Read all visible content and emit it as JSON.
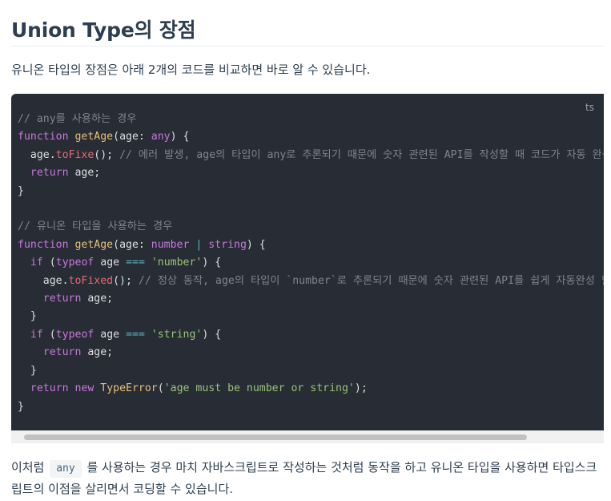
{
  "heading": "Union Type의 장점",
  "intro": "유니온 타입의 장점은 아래 2개의 코드를 비교하면 바로 알 수 있습니다.",
  "code": {
    "language": "ts",
    "lines": {
      "l1": "// any를 사용하는 경우",
      "l2_kw": "function",
      "l2_fn": "getAge",
      "l2_p1": "(age: ",
      "l2_type": "any",
      "l2_p2": ") {",
      "l3_obj": "age.",
      "l3_method": "toFixe",
      "l3_p": "();",
      "l3_comment": "// 에러 발생, age의 타입이 any로 추론되기 때문에 숫자 관련된 API를 작성할 때 코드가 자동 완성",
      "l4_kw": "return",
      "l4_rest": "age;",
      "l5": "}",
      "l7": "// 유니온 타입을 사용하는 경우",
      "l8_kw": "function",
      "l8_fn": "getAge",
      "l8_p1": "(age: ",
      "l8_t1": "number",
      "l8_op": "|",
      "l8_t2": "string",
      "l8_p2": ") {",
      "l9_kw1": "if",
      "l9_p1": "(",
      "l9_kw2": "typeof",
      "l9_p2": "age",
      "l9_op": "===",
      "l9_str": "'number'",
      "l9_p3": ") {",
      "l10_obj": "age.",
      "l10_method": "toFixed",
      "l10_p": "();",
      "l10_comment": "// 정상 동작, age의 타입이 `number`로 추론되기 때문에 숫자 관련된 API를 쉽게 자동완성 할",
      "l11_kw": "return",
      "l11_rest": "age;",
      "l12": "}",
      "l13_kw1": "if",
      "l13_p1": "(",
      "l13_kw2": "typeof",
      "l13_p2": "age",
      "l13_op": "===",
      "l13_str": "'string'",
      "l13_p3": ") {",
      "l14_kw": "return",
      "l14_rest": "age;",
      "l15": "}",
      "l16_kw1": "return",
      "l16_kw2": "new",
      "l16_cls": "TypeError",
      "l16_p1": "(",
      "l16_str": "'age must be number or string'",
      "l16_p2": ");",
      "l17": "}"
    }
  },
  "outro": {
    "before": "이처럼",
    "inline_code": "any",
    "after": "를 사용하는 경우 마치 자바스크립트로 작성하는 것처럼 동작을 하고 유니온 타입을 사용하면 타입스크립트의 이점을 살리면서 코딩할 수 있습니다."
  }
}
